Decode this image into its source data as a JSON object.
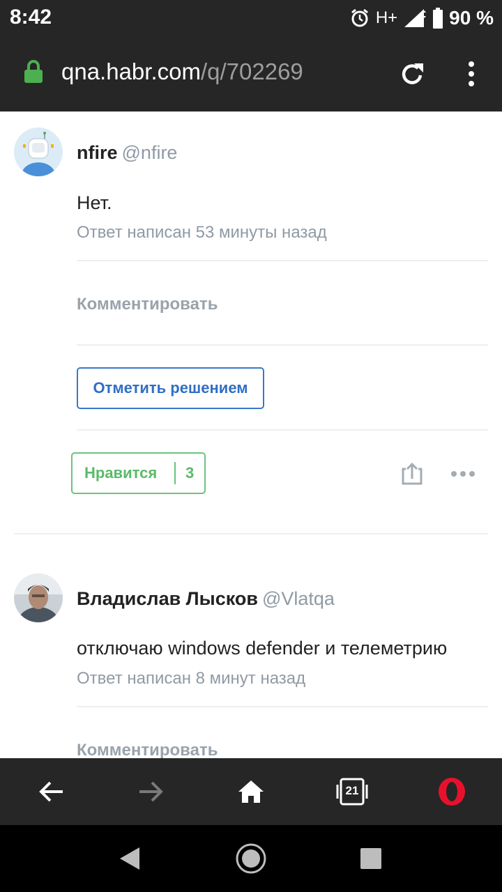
{
  "status_bar": {
    "time": "8:42",
    "network": "H+",
    "battery": "90 %"
  },
  "url_bar": {
    "host": "qna.habr.com",
    "path": "/q/702269"
  },
  "answers": [
    {
      "author_name": "nfire",
      "author_handle": "@nfire",
      "text": "Нет.",
      "meta": "Ответ написан 53 минуты назад",
      "comment_label": "Комментировать",
      "mark_solution_label": "Отметить решением",
      "like_label": "Нравится",
      "like_count": "3"
    },
    {
      "author_name": "Владислав Лысков",
      "author_handle": "@Vlatqa",
      "text": "отключаю windows defender и телеметрию",
      "meta": "Ответ написан 8 минут назад",
      "comment_label": "Комментировать"
    }
  ],
  "browser_bar": {
    "tabs_count": "21"
  },
  "colors": {
    "bar_background": "#262626",
    "accent_blue": "#2f6fc4",
    "accent_green": "#5aba69",
    "lock_green": "#4caf50",
    "opera_red": "#e8112d"
  }
}
